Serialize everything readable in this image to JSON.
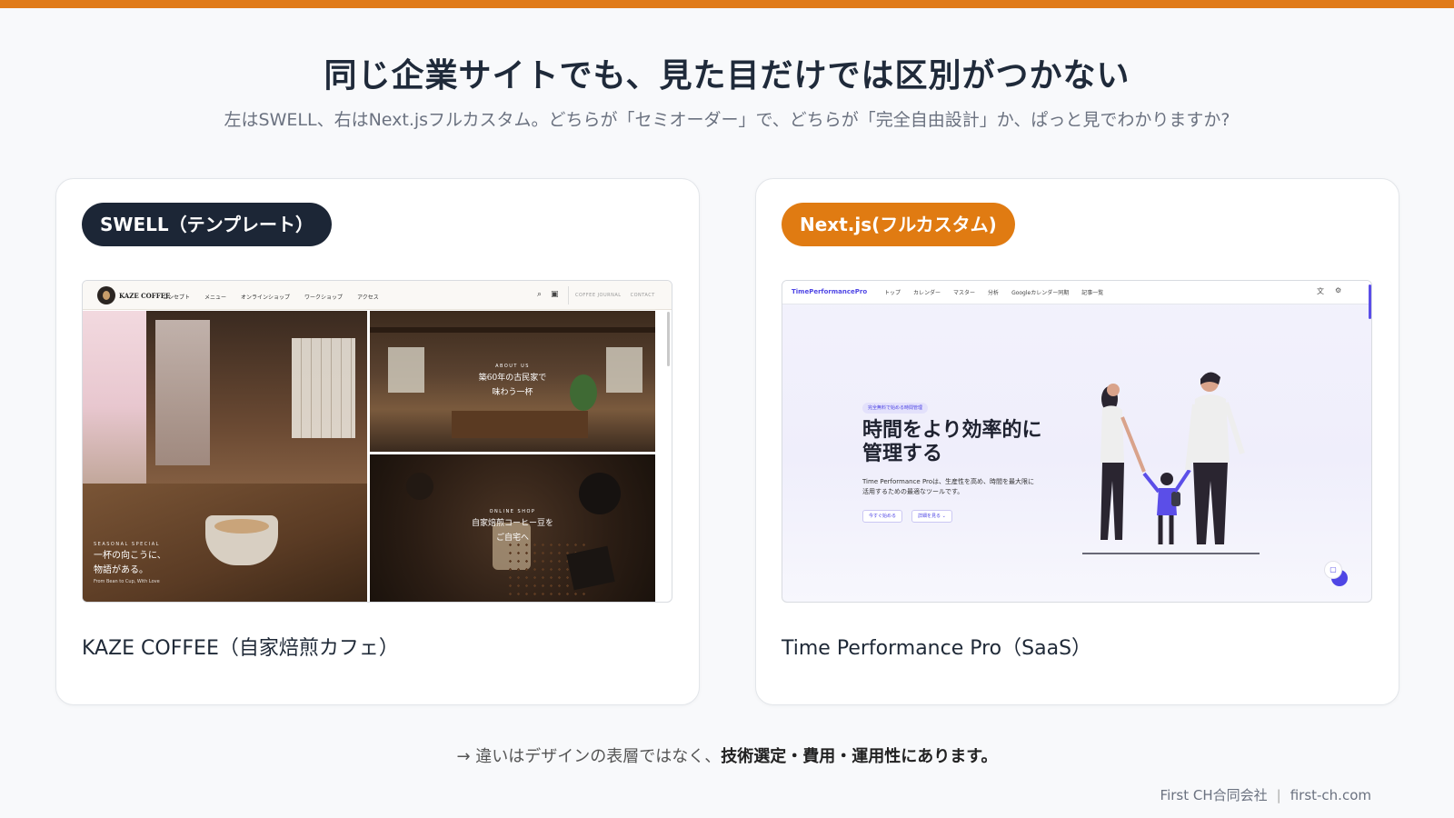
{
  "header": {
    "title": "同じ企業サイトでも、見た目だけでは区別がつかない",
    "subtitle": "左はSWELL、右はNext.jsフルカスタム。どちらが「セミオーダー」で、どちらが「完全自由設計」か、ぱっと見でわかりますか?"
  },
  "colors": {
    "accent": "#e07b1a",
    "dark": "#1c2636",
    "indigo": "#4f46e5"
  },
  "left_card": {
    "pill": "SWELL（テンプレート）",
    "caption": "KAZE COFFEE（自家焙煎カフェ）",
    "screenshot": {
      "logo": "KAZE COFFEE",
      "menu": [
        "コンセプト",
        "メニュー",
        "オンラインショップ",
        "ワークショップ",
        "アクセス"
      ],
      "icons": [
        "search-icon",
        "cart-icon"
      ],
      "right_links": [
        "COFFEE JOURNAL",
        "CONTACT"
      ],
      "tile_big": {
        "kicker": "SEASONAL SPECIAL",
        "heading_1": "一杯の向こうに、",
        "heading_2": "物語がある。",
        "sub": "From Bean to Cup, With Love"
      },
      "tile_top": {
        "kicker": "ABOUT US",
        "heading_1": "築60年の古民家で",
        "heading_2": "味わう一杯"
      },
      "tile_bottom": {
        "kicker": "ONLINE SHOP",
        "heading_1": "自家焙煎コーヒー豆を",
        "heading_2": "ご自宅へ"
      }
    }
  },
  "right_card": {
    "pill": "Next.js(フルカスタム)",
    "caption": "Time Performance Pro（SaaS）",
    "screenshot": {
      "brand": "TimePerformancePro",
      "menu": [
        "トップ",
        "カレンダー",
        "マスター",
        "分析",
        "Googleカレンダー同期",
        "記事一覧"
      ],
      "icons": [
        "translate-icon",
        "gear-icon"
      ],
      "badge": "完全無料で始める時間管理",
      "heading_1": "時間をより効率的に",
      "heading_2": "管理する",
      "desc_1": "Time Performance Proは、生産性を高め、時間を最大限に",
      "desc_2": "活用するための最適なツールです。",
      "btn_primary": "今すぐ始める",
      "btn_secondary": "詳細を見る ⌄"
    }
  },
  "footnote": {
    "prefix": "→ 違いはデザインの表層ではなく、",
    "emphasis": "技術選定・費用・運用性にあります。"
  },
  "footer": {
    "company": "First CH合同会社",
    "separator": "|",
    "domain": "first-ch.com"
  }
}
